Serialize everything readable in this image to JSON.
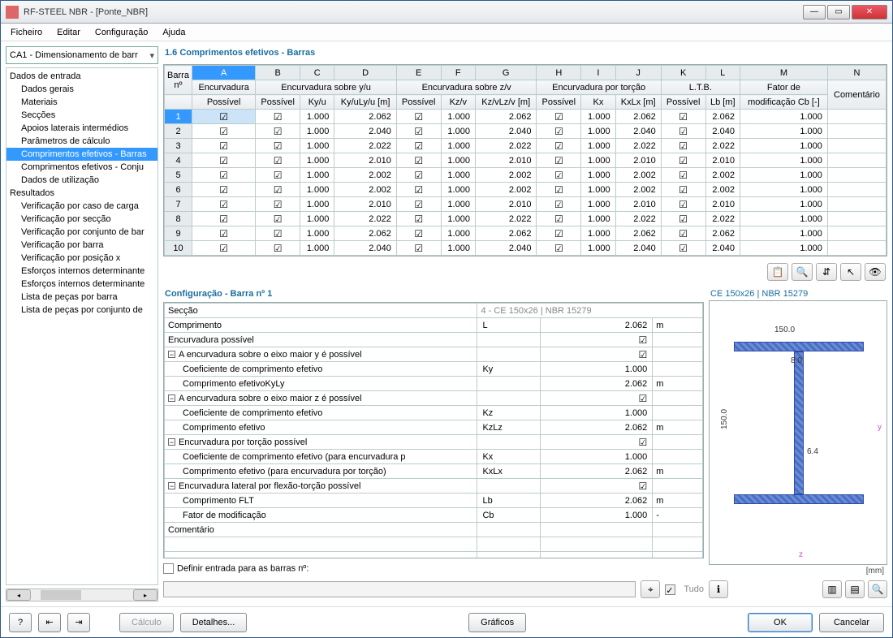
{
  "window": {
    "title": "RF-STEEL NBR - [Ponte_NBR]"
  },
  "menu": [
    "Ficheiro",
    "Editar",
    "Configuração",
    "Ajuda"
  ],
  "combo": "CA1 - Dimensionamento de barr",
  "tree": {
    "r1": "Dados de entrada",
    "i1": "Dados gerais",
    "i2": "Materiais",
    "i3": "Secções",
    "i4": "Apoios laterais intermédios",
    "i5": "Parâmetros de cálculo",
    "i6": "Comprimentos efetivos - Barras",
    "i7": "Comprimentos efetivos - Conju",
    "i8": "Dados de utilização",
    "r2": "Resultados",
    "j1": "Verificação por caso de carga",
    "j2": "Verificação por secção",
    "j3": "Verificação por conjunto de bar",
    "j4": "Verificação por barra",
    "j5": "Verificação por posição x",
    "j6": "Esforços internos determinante",
    "j7": "Esforços internos determinante",
    "j8": "Lista de peças por barra",
    "j9": "Lista de peças por conjunto de"
  },
  "panetitle": "1.6 Comprimentos efetivos - Barras",
  "gridhead": {
    "cols": [
      "A",
      "B",
      "C",
      "D",
      "E",
      "F",
      "G",
      "H",
      "I",
      "J",
      "K",
      "L",
      "M",
      "N"
    ],
    "barra": "Barra",
    "no": "nº",
    "g1": "Encurvadura",
    "g1a": "Possível",
    "g2": "Encurvadura sobre y/u",
    "g2a": "Possível",
    "g2b": "Ky/u",
    "g2c": "Ky/uLy/u [m]",
    "g3": "Encurvadura sobre z/v",
    "g3a": "Possível",
    "g3b": "Kz/v",
    "g3c": "Kz/vLz/v [m]",
    "g4": "Encurvadura por torção",
    "g4a": "Possível",
    "g4b": "Kx",
    "g4c": "KxLx [m]",
    "g5": "L.T.B.",
    "g5a": "Possível",
    "g5b": "Lb [m]",
    "g6": "Fator de",
    "g6b": "modificação Cb [-]",
    "g7": "Comentário"
  },
  "rows": [
    {
      "n": "1",
      "kyu": "1.000",
      "lyu": "2.062",
      "kzv": "1.000",
      "lzv": "2.062",
      "kx": "1.000",
      "lx": "2.062",
      "lb": "2.062",
      "cb": "1.000"
    },
    {
      "n": "2",
      "kyu": "1.000",
      "lyu": "2.040",
      "kzv": "1.000",
      "lzv": "2.040",
      "kx": "1.000",
      "lx": "2.040",
      "lb": "2.040",
      "cb": "1.000"
    },
    {
      "n": "3",
      "kyu": "1.000",
      "lyu": "2.022",
      "kzv": "1.000",
      "lzv": "2.022",
      "kx": "1.000",
      "lx": "2.022",
      "lb": "2.022",
      "cb": "1.000"
    },
    {
      "n": "4",
      "kyu": "1.000",
      "lyu": "2.010",
      "kzv": "1.000",
      "lzv": "2.010",
      "kx": "1.000",
      "lx": "2.010",
      "lb": "2.010",
      "cb": "1.000"
    },
    {
      "n": "5",
      "kyu": "1.000",
      "lyu": "2.002",
      "kzv": "1.000",
      "lzv": "2.002",
      "kx": "1.000",
      "lx": "2.002",
      "lb": "2.002",
      "cb": "1.000"
    },
    {
      "n": "6",
      "kyu": "1.000",
      "lyu": "2.002",
      "kzv": "1.000",
      "lzv": "2.002",
      "kx": "1.000",
      "lx": "2.002",
      "lb": "2.002",
      "cb": "1.000"
    },
    {
      "n": "7",
      "kyu": "1.000",
      "lyu": "2.010",
      "kzv": "1.000",
      "lzv": "2.010",
      "kx": "1.000",
      "lx": "2.010",
      "lb": "2.010",
      "cb": "1.000"
    },
    {
      "n": "8",
      "kyu": "1.000",
      "lyu": "2.022",
      "kzv": "1.000",
      "lzv": "2.022",
      "kx": "1.000",
      "lx": "2.022",
      "lb": "2.022",
      "cb": "1.000"
    },
    {
      "n": "9",
      "kyu": "1.000",
      "lyu": "2.062",
      "kzv": "1.000",
      "lzv": "2.062",
      "kx": "1.000",
      "lx": "2.062",
      "lb": "2.062",
      "cb": "1.000"
    },
    {
      "n": "10",
      "kyu": "1.000",
      "lyu": "2.040",
      "kzv": "1.000",
      "lzv": "2.040",
      "kx": "1.000",
      "lx": "2.040",
      "lb": "2.040",
      "cb": "1.000"
    }
  ],
  "cfg": {
    "title": "Configuração - Barra nº 1",
    "seccao_l": "Secção",
    "seccao_v": "4 - CE 150x26 | NBR 15279",
    "comp_l": "Comprimento",
    "comp_s": "L",
    "comp_v": "2.062",
    "m": "m",
    "enc_l": "Encurvadura possível",
    "gy_l": "A encurvadura sobre o eixo maior y é possível",
    "gy1_l": "Coeficiente de comprimento efetivo",
    "gy1_s": "Ky",
    "gy1_v": "1.000",
    "gy2_l": "Comprimento efetivoKyLy",
    "gy2_v": "2.062",
    "gz_l": "A encurvadura sobre o eixo maior z é possível",
    "gz1_l": "Coeficiente de comprimento efetivo",
    "gz1_s": "Kz",
    "gz1_v": "1.000",
    "gz2_l": "Comprimento efetivo",
    "gz2_s": "KzLz",
    "gz2_v": "2.062",
    "gt_l": "Encurvadura por torção possível",
    "gt1_l": "Coeficiente de comprimento efetivo (para encurvadura p",
    "gt1_s": "Kx",
    "gt1_v": "1.000",
    "gt2_l": "Comprimento efetivo (para encurvadura por torção)",
    "gt2_s": "KxLx",
    "gt2_v": "2.062",
    "lt_l": "Encurvadura lateral por flexão-torção possível",
    "lt1_l": "Comprimento FLT",
    "lt1_s": "Lb",
    "lt1_v": "2.062",
    "lt2_l": "Fator de modificação",
    "lt2_s": "Cb",
    "lt2_v": "1.000",
    "dash": "-",
    "com_l": "Comentário"
  },
  "define_l": "Definir entrada para as barras nº:",
  "tudo": "Tudo",
  "preview": {
    "title": "CE 150x26 | NBR 15279",
    "w": "150.0",
    "h": "150.0",
    "tf": "8.0",
    "tw": "6.4",
    "unit": "[mm]"
  },
  "buttons": {
    "calc": "Cálculo",
    "det": "Detalhes...",
    "graf": "Gráficos",
    "ok": "OK",
    "cancel": "Cancelar"
  }
}
